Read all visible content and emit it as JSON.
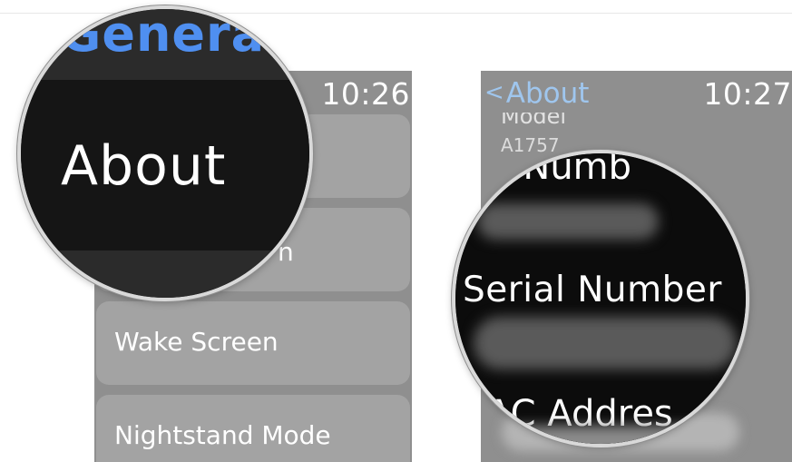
{
  "left_screen": {
    "time": "10:26",
    "items": [
      {
        "label": ""
      },
      {
        "label": "n"
      },
      {
        "label": "Wake Screen"
      },
      {
        "label": "Nightstand Mode"
      }
    ],
    "magnifier": {
      "header": "Genera",
      "selected": "About"
    }
  },
  "right_screen": {
    "time": "10:27",
    "back_label": "About",
    "back_glyph": "<",
    "model_heading": "Model",
    "model_value": "A1757",
    "magnifier": {
      "part_number": "t Numb",
      "serial_number": "Serial Number",
      "mac_address": "AC Addres"
    }
  },
  "colors": {
    "accent_blue": "#4f8ff0",
    "nav_blue": "#9fc6ee",
    "watch_bg": "#8f8f8f"
  }
}
